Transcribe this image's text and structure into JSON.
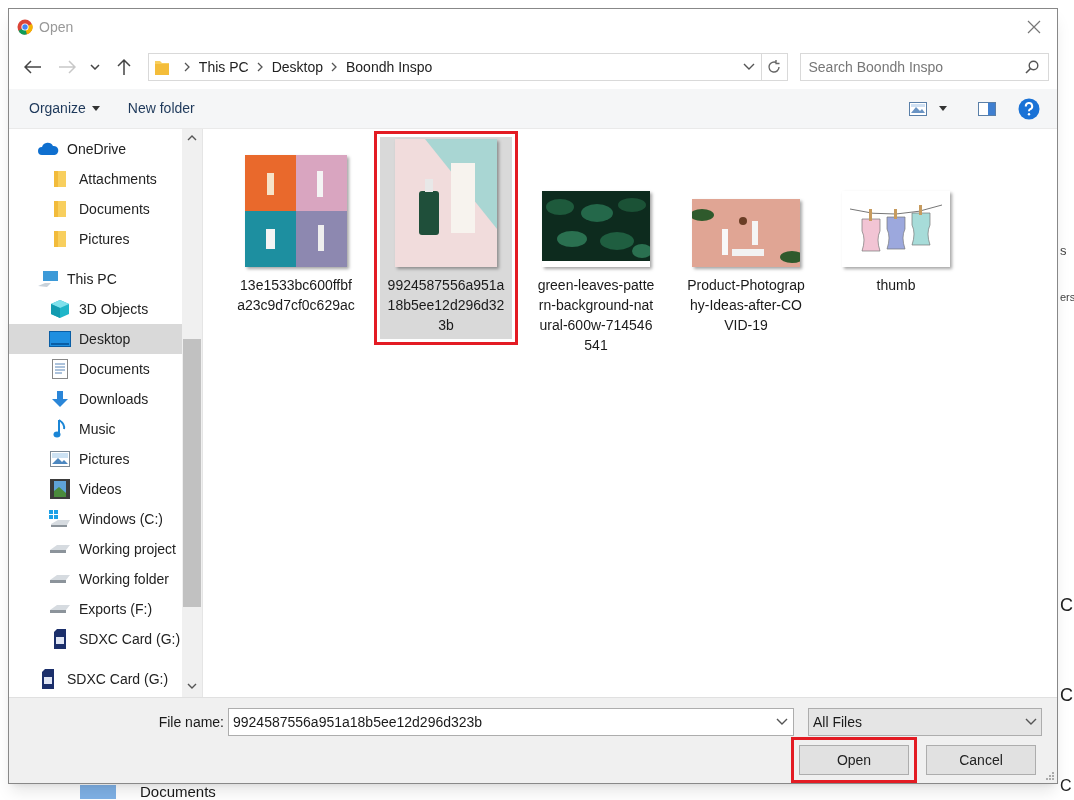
{
  "window": {
    "title": "Open"
  },
  "nav_buttons": [
    {
      "kind": "back",
      "disabled": false
    },
    {
      "kind": "forward",
      "disabled": true
    },
    {
      "kind": "recent",
      "disabled": false
    },
    {
      "kind": "up",
      "disabled": false
    }
  ],
  "address": {
    "segments": [
      "This PC",
      "Desktop",
      "Boondh Inspo"
    ]
  },
  "search": {
    "placeholder": "Search Boondh Inspo"
  },
  "toolbar": {
    "organize": "Organize",
    "new_folder": "New folder"
  },
  "sidebar": {
    "items": [
      {
        "label": "OneDrive",
        "kind": "cloud",
        "selected": false,
        "children": [
          {
            "label": "Attachments",
            "kind": "folder",
            "selected": false
          },
          {
            "label": "Documents",
            "kind": "folder",
            "selected": false
          },
          {
            "label": "Pictures",
            "kind": "folder",
            "selected": false
          }
        ]
      },
      {
        "label": "This PC",
        "kind": "pc",
        "selected": false,
        "children": [
          {
            "label": "3D Objects",
            "kind": "cube",
            "selected": false
          },
          {
            "label": "Desktop",
            "kind": "desktop",
            "selected": true
          },
          {
            "label": "Documents",
            "kind": "docs",
            "selected": false
          },
          {
            "label": "Downloads",
            "kind": "download",
            "selected": false
          },
          {
            "label": "Music",
            "kind": "music",
            "selected": false
          },
          {
            "label": "Pictures",
            "kind": "pictures",
            "selected": false
          },
          {
            "label": "Videos",
            "kind": "videos",
            "selected": false
          },
          {
            "label": "Windows (C:)",
            "kind": "windrive",
            "selected": false
          },
          {
            "label": "Working project",
            "kind": "drive",
            "selected": false
          },
          {
            "label": "Working folder",
            "kind": "drive",
            "selected": false
          },
          {
            "label": "Exports (F:)",
            "kind": "drive",
            "selected": false
          },
          {
            "label": "SDXC Card (G:)",
            "kind": "sd",
            "selected": false
          }
        ]
      },
      {
        "label": "SDXC Card (G:)",
        "kind": "sd",
        "selected": false
      }
    ]
  },
  "files": [
    {
      "name": "13e1533bc600ffbfa23c9d7cf0c629ac",
      "selected": false,
      "highlighted": false
    },
    {
      "name": "9924587556a951a18b5ee12d296d323b",
      "selected": true,
      "highlighted": true
    },
    {
      "name": "green-leaves-pattern-background-natural-600w-714546541",
      "selected": false,
      "highlighted": false
    },
    {
      "name": "Product-Photography-Ideas-after-COVID-19",
      "selected": false,
      "highlighted": false
    },
    {
      "name": "thumb",
      "selected": false,
      "highlighted": false
    }
  ],
  "file_name": {
    "label": "File name:",
    "value": "9924587556a951a18b5ee12d296d323b"
  },
  "filter": {
    "value": "All Files"
  },
  "buttons": [
    {
      "label": "Open",
      "highlighted": true
    },
    {
      "label": "Cancel",
      "highlighted": false
    }
  ],
  "background": {
    "fragments": [
      "s",
      "ers",
      "C",
      "C",
      "C"
    ],
    "bottom_item": "Documents"
  }
}
